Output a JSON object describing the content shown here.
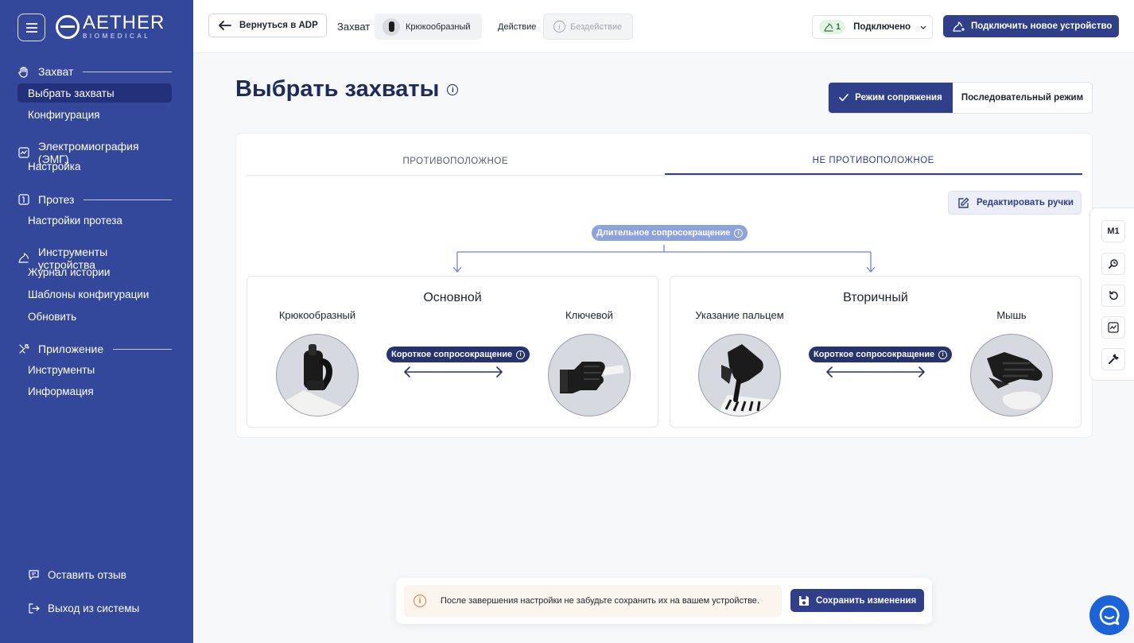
{
  "brand": {
    "name": "AETHER",
    "sub": "BIOMEDICAL"
  },
  "sidebar": {
    "sections": [
      {
        "title": "Захват",
        "icon": "hand-icon",
        "items": [
          {
            "label": "Выбрать захваты",
            "active": true
          },
          {
            "label": "Конфигурация"
          }
        ]
      },
      {
        "title": "Электромиография (ЭМГ)",
        "icon": "emg-chart-icon",
        "items": [
          {
            "label": "Настройка"
          }
        ]
      },
      {
        "title": "Протез",
        "icon": "prosthesis-icon",
        "items": [
          {
            "label": "Настройки протеза"
          }
        ]
      },
      {
        "title": "Инструменты устройства",
        "icon": "device-tools-icon",
        "items": [
          {
            "label": "Журнал истории"
          },
          {
            "label": "Шаблоны конфигурации"
          },
          {
            "label": "Обновить"
          }
        ]
      },
      {
        "title": "Приложение",
        "icon": "tools-icon",
        "items": [
          {
            "label": "Инструменты"
          },
          {
            "label": "Информация"
          }
        ]
      }
    ],
    "footer": {
      "feedback": "Оставить отзыв",
      "logout": "Выход из системы"
    }
  },
  "topbar": {
    "back_label": "Вернуться в ADP",
    "grip_label": "Захват",
    "grip_value": "Крюкообразный",
    "action_label": "Действие",
    "action_value": "Бездействие",
    "connection_count": "1",
    "connection_status": "Подключено",
    "new_device_label": "Подключить новое устройство"
  },
  "page": {
    "title": "Выбрать захваты",
    "modes": {
      "active": "Режим сопряжения",
      "inactive": "Последовательный режим"
    },
    "tabs": [
      {
        "label": "ПРОТИВОПОЛОЖНОЕ"
      },
      {
        "label": "НЕ ПРОТИВОПОЛОЖНОЕ",
        "active": true
      }
    ],
    "edit_label": "Редактировать ручки",
    "long_cocontraction": "Длительное сопросокращение",
    "groups": [
      {
        "title": "Основной",
        "left_grip": "Крюкообразный",
        "right_grip": "Ключевой",
        "short_cocontraction": "Короткое сопросокращение"
      },
      {
        "title": "Вторичный",
        "left_grip": "Указание пальцем",
        "right_grip": "Мышь",
        "short_cocontraction": "Короткое сопросокращение"
      }
    ]
  },
  "right_toolbar": {
    "m1_label": "M1"
  },
  "save_bar": {
    "message": "После завершения настройки не забудьте сохранить их на вашем устройстве.",
    "save_label": "Сохранить изменения"
  },
  "colors": {
    "sidebar": "#33479b",
    "primary": "#2f3f8a",
    "accent_light": "#8ea3dd",
    "warning": "#e07a2d"
  }
}
